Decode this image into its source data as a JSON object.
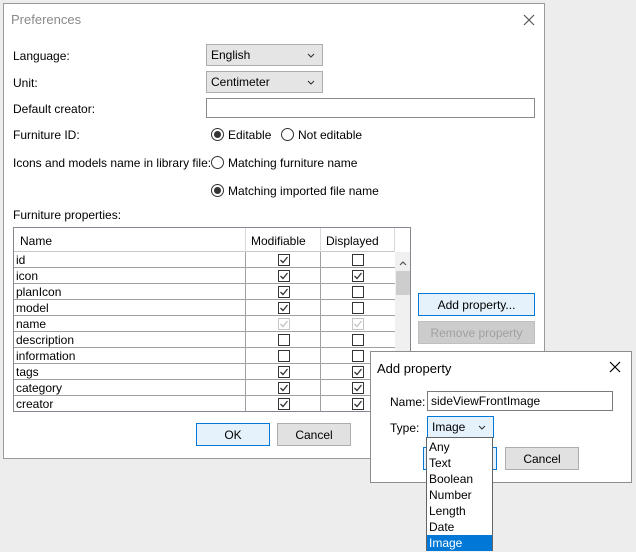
{
  "prefs": {
    "title": "Preferences",
    "language_label": "Language:",
    "language_value": "English",
    "unit_label": "Unit:",
    "unit_value": "Centimeter",
    "default_creator_label": "Default creator:",
    "default_creator_value": "",
    "furniture_id_label": "Furniture ID:",
    "furniture_id_options": [
      "Editable",
      "Not editable"
    ],
    "furniture_id_selected": "Editable",
    "icons_models_label": "Icons and models name in library file:",
    "icons_models_options": [
      "Matching furniture name",
      "Matching imported file name"
    ],
    "icons_models_selected": "Matching imported file name",
    "furniture_props_label": "Furniture properties:",
    "table": {
      "columns": [
        "Name",
        "Modifiable",
        "Displayed"
      ],
      "rows": [
        {
          "name": "id",
          "modifiable": true,
          "displayed": false,
          "enabled": true
        },
        {
          "name": "icon",
          "modifiable": true,
          "displayed": true,
          "enabled": true
        },
        {
          "name": "planIcon",
          "modifiable": true,
          "displayed": false,
          "enabled": true
        },
        {
          "name": "model",
          "modifiable": true,
          "displayed": false,
          "enabled": true
        },
        {
          "name": "name",
          "modifiable": true,
          "displayed": true,
          "enabled": false
        },
        {
          "name": "description",
          "modifiable": false,
          "displayed": false,
          "enabled": true
        },
        {
          "name": "information",
          "modifiable": false,
          "displayed": false,
          "enabled": true
        },
        {
          "name": "tags",
          "modifiable": true,
          "displayed": true,
          "enabled": true
        },
        {
          "name": "category",
          "modifiable": true,
          "displayed": true,
          "enabled": true
        },
        {
          "name": "creator",
          "modifiable": true,
          "displayed": true,
          "enabled": true
        }
      ]
    },
    "add_property_button": "Add property...",
    "remove_property_button": "Remove property",
    "ok_button": "OK",
    "cancel_button": "Cancel"
  },
  "add_dialog": {
    "title": "Add property",
    "name_label": "Name:",
    "name_value": "sideViewFrontImage",
    "type_label": "Type:",
    "type_value": "Image",
    "cancel_button": "Cancel",
    "type_options": [
      "Any",
      "Text",
      "Boolean",
      "Number",
      "Length",
      "Date",
      "Image"
    ],
    "type_selected": "Image"
  },
  "colors": {
    "accent": "#0078d7",
    "window_bg": "#ffffff",
    "desktop_bg": "#ededed"
  }
}
